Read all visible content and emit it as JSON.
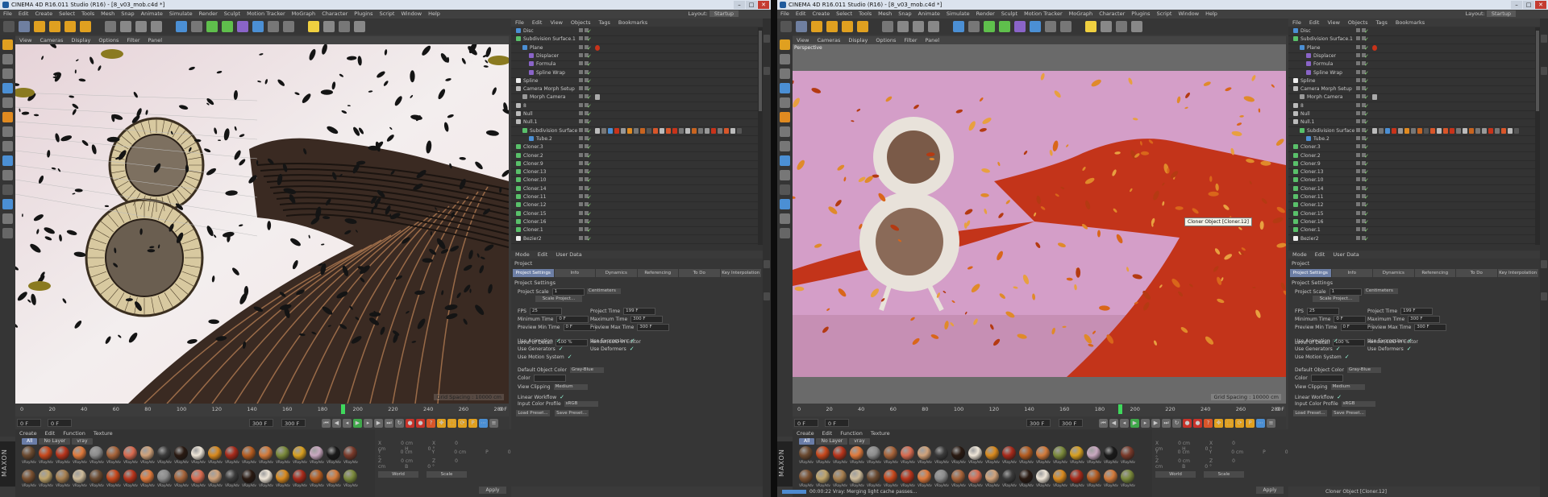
{
  "screens": [
    {
      "window_title": "CINEMA 4D R16.011 Studio (R16) - [8_v03_mob.c4d *]",
      "menus": [
        "File",
        "Edit",
        "Create",
        "Select",
        "Tools",
        "Mesh",
        "Snap",
        "Animate",
        "Simulate",
        "Render",
        "Sculpt",
        "Motion Tracker",
        "MoGraph",
        "Character",
        "Plugins",
        "Script",
        "Window",
        "Help"
      ],
      "layout_label": "Layout:",
      "layout_value": "Startup",
      "viewport_menu": [
        "View",
        "Cameras",
        "Display",
        "Options",
        "Filter",
        "Panel"
      ],
      "viewport_label": "",
      "viewport_render_mode": "wireframe",
      "grid_spacing": "Grid Spacing : 10000 cm",
      "timeline_ticks": [
        "0",
        "20",
        "40",
        "60",
        "80",
        "100",
        "120",
        "140",
        "160",
        "180",
        "200",
        "220",
        "240",
        "260",
        "280"
      ],
      "timeline_end": "0 F",
      "current_frame_marker": "199",
      "playhead_fraction": 0.663,
      "transport_fields": [
        "0 F",
        "0 F",
        "300 F",
        "300 F"
      ],
      "material_menu": [
        "Create",
        "Edit",
        "Function",
        "Texture"
      ],
      "material_filters": [
        "All",
        "No Layer",
        "vray"
      ],
      "material_label": "VRayAdv",
      "coord_rows": [
        [
          "X",
          "0 cm",
          "X",
          "0 cm",
          "H",
          "0 °"
        ],
        [
          "Y",
          "0 cm",
          "Y",
          "0 cm",
          "P",
          "0 °"
        ],
        [
          "Z",
          "0 cm",
          "Z",
          "0 cm",
          "B",
          "0 °"
        ]
      ],
      "coord_dropdowns": [
        "World",
        "Scale"
      ],
      "apply_label": "Apply",
      "status_text": "",
      "tooltip": "",
      "progress": null
    },
    {
      "window_title": "CINEMA 4D R16.011 Studio (R16) - [8_v03_mob.c4d *]",
      "menus": [
        "File",
        "Edit",
        "Create",
        "Select",
        "Tools",
        "Mesh",
        "Snap",
        "Animate",
        "Simulate",
        "Render",
        "Sculpt",
        "Motion Tracker",
        "MoGraph",
        "Character",
        "Plugins",
        "Script",
        "Window",
        "Help"
      ],
      "layout_label": "Layout:",
      "layout_value": "Startup",
      "viewport_menu": [
        "View",
        "Cameras",
        "Display",
        "Options",
        "Filter",
        "Panel"
      ],
      "viewport_label": "Perspective",
      "viewport_render_mode": "render",
      "grid_spacing": "Grid Spacing : 10000 cm",
      "timeline_ticks": [
        "0",
        "20",
        "40",
        "60",
        "80",
        "100",
        "120",
        "140",
        "160",
        "180",
        "200",
        "220",
        "240",
        "260",
        "280"
      ],
      "timeline_end": "0 F",
      "current_frame_marker": "199",
      "playhead_fraction": 0.663,
      "transport_fields": [
        "0 F",
        "0 F",
        "300 F",
        "300 F"
      ],
      "material_menu": [
        "Create",
        "Edit",
        "Function",
        "Texture"
      ],
      "material_filters": [
        "All",
        "No Layer",
        "vray"
      ],
      "material_label": "VRayAdv",
      "coord_rows": [
        [
          "X",
          "0 cm",
          "X",
          "0 cm",
          "H",
          "0 °"
        ],
        [
          "Y",
          "0 cm",
          "Y",
          "0 cm",
          "P",
          "0 °"
        ],
        [
          "Z",
          "0 cm",
          "Z",
          "0 cm",
          "B",
          "0 °"
        ]
      ],
      "coord_dropdowns": [
        "World",
        "Scale"
      ],
      "apply_label": "Apply",
      "status_text": "Cloner Object [Cloner.12]",
      "tooltip": "Cloner Object [Cloner.12]",
      "progress": {
        "fraction": 0.25,
        "text": "00:00:22 Vray: Merging light cache passes..."
      }
    }
  ],
  "object_manager": {
    "menu": [
      "File",
      "Edit",
      "View",
      "Objects",
      "Tags",
      "Bookmarks"
    ],
    "rows": [
      {
        "name": "Disc",
        "depth": 0,
        "icon": "disc-icon"
      },
      {
        "name": "Subdivision Surface.1",
        "depth": 0,
        "icon": "subdivision-icon"
      },
      {
        "name": "Plane",
        "depth": 1,
        "icon": "plane-icon"
      },
      {
        "name": "Displacer",
        "depth": 2,
        "icon": "displacer-icon"
      },
      {
        "name": "Formula",
        "depth": 2,
        "icon": "formula-icon"
      },
      {
        "name": "Spline Wrap",
        "depth": 2,
        "icon": "spline-wrap-icon"
      },
      {
        "name": "Spline",
        "depth": 0,
        "icon": "spline-icon"
      },
      {
        "name": "Camera Morph Setup",
        "depth": 0,
        "icon": "null-icon"
      },
      {
        "name": "Morph Camera",
        "depth": 1,
        "icon": "camera-icon"
      },
      {
        "name": "8",
        "depth": 0,
        "icon": "null-icon"
      },
      {
        "name": "Null",
        "depth": 0,
        "icon": "null-icon"
      },
      {
        "name": "Null.1",
        "depth": 0,
        "icon": "null-icon"
      },
      {
        "name": "Subdivision Surface",
        "depth": 1,
        "icon": "subdivision-icon"
      },
      {
        "name": "Tube.2",
        "depth": 2,
        "icon": "tube-icon"
      },
      {
        "name": "Cloner.3",
        "depth": 0,
        "icon": "cloner-icon"
      },
      {
        "name": "Cloner.2",
        "depth": 0,
        "icon": "cloner-icon"
      },
      {
        "name": "Cloner.9",
        "depth": 0,
        "icon": "cloner-icon"
      },
      {
        "name": "Cloner.13",
        "depth": 0,
        "icon": "cloner-icon"
      },
      {
        "name": "Cloner.10",
        "depth": 0,
        "icon": "cloner-icon"
      },
      {
        "name": "Cloner.14",
        "depth": 0,
        "icon": "cloner-icon"
      },
      {
        "name": "Cloner.11",
        "depth": 0,
        "icon": "cloner-icon"
      },
      {
        "name": "Cloner.12",
        "depth": 0,
        "icon": "cloner-icon"
      },
      {
        "name": "Cloner.15",
        "depth": 0,
        "icon": "cloner-icon"
      },
      {
        "name": "Cloner.16",
        "depth": 0,
        "icon": "cloner-icon"
      },
      {
        "name": "Cloner.1",
        "depth": 0,
        "icon": "cloner-icon"
      },
      {
        "name": "Bezier2",
        "depth": 0,
        "icon": "bezier-icon"
      }
    ]
  },
  "attributes": {
    "menu": [
      "Mode",
      "Edit",
      "User Data"
    ],
    "title": "Project",
    "tabs": [
      "Project Settings",
      "Info",
      "Dynamics",
      "Referencing",
      "To Do",
      "Key Interpolation"
    ],
    "active_tab": 0,
    "section": "Project Settings",
    "project_scale_label": "Project Scale",
    "project_scale_value": "1",
    "project_scale_unit": "Centimeters",
    "scale_button": "Scale Project...",
    "left_fields": [
      {
        "label": "FPS",
        "value": "25"
      },
      {
        "label": "Minimum Time",
        "value": "0 F"
      },
      {
        "label": "Preview Min Time",
        "value": "0 F"
      },
      {
        "label": "Level of Detail",
        "value": "100 %"
      }
    ],
    "right_fields": [
      {
        "label": "Project Time",
        "value": "199 F"
      },
      {
        "label": "Maximum Time",
        "value": "300 F"
      },
      {
        "label": "Preview Max Time",
        "value": "300 F"
      },
      {
        "label": "Render LOD in Editor",
        "value": ""
      }
    ],
    "left_checks": [
      "Use Animation",
      "Use Generators",
      "Use Motion System"
    ],
    "right_checks": [
      "Use Expression",
      "Use Deformers"
    ],
    "default_color_label": "Default Object Color",
    "default_color_value": "Gray-Blue",
    "color_label": "Color",
    "view_clipping_label": "View Clipping",
    "view_clipping_value": "Medium",
    "linear_workflow_label": "Linear Workflow",
    "input_color_label": "Input Color Profile",
    "input_color_value": "sRGB",
    "load_button": "Load Preset...",
    "save_button": "Save Preset..."
  },
  "colors": {
    "accent": "#6d7fa6",
    "playhead": "#3fd85c",
    "check": "#8bdc7a",
    "ui_bg": "#3a3a3a"
  }
}
